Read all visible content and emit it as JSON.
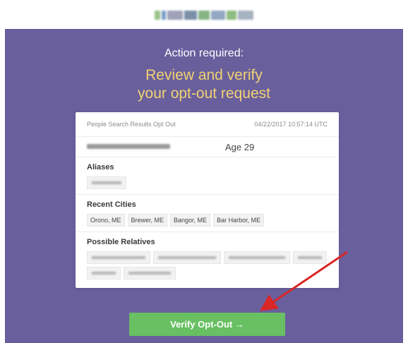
{
  "header": {
    "logo_icon": "blurred-logo-icon"
  },
  "banner": {
    "action_label": "Action required:",
    "headline_line1": "Review and verify",
    "headline_line2": "your opt-out request",
    "background_color": "#6a5f9d",
    "headline_color": "#f1d371"
  },
  "card": {
    "header_left": "People Search Results Opt Out",
    "header_right": "04/22/2017 10:57:14 UTC",
    "age_text": "Age 29",
    "sections": {
      "aliases": {
        "title": "Aliases"
      },
      "recent_cities": {
        "title": "Recent Cities",
        "items": [
          "Orono, ME",
          "Brewer, ME",
          "Bangor, ME",
          "Bar Harbor, ME"
        ]
      },
      "possible_relatives": {
        "title": "Possible Relatives"
      }
    }
  },
  "actions": {
    "verify_label": "Verify Opt-Out →",
    "verify_color": "#68c062"
  },
  "annotation": {
    "arrow_icon": "red-arrow-icon",
    "arrow_color": "#d92626"
  }
}
